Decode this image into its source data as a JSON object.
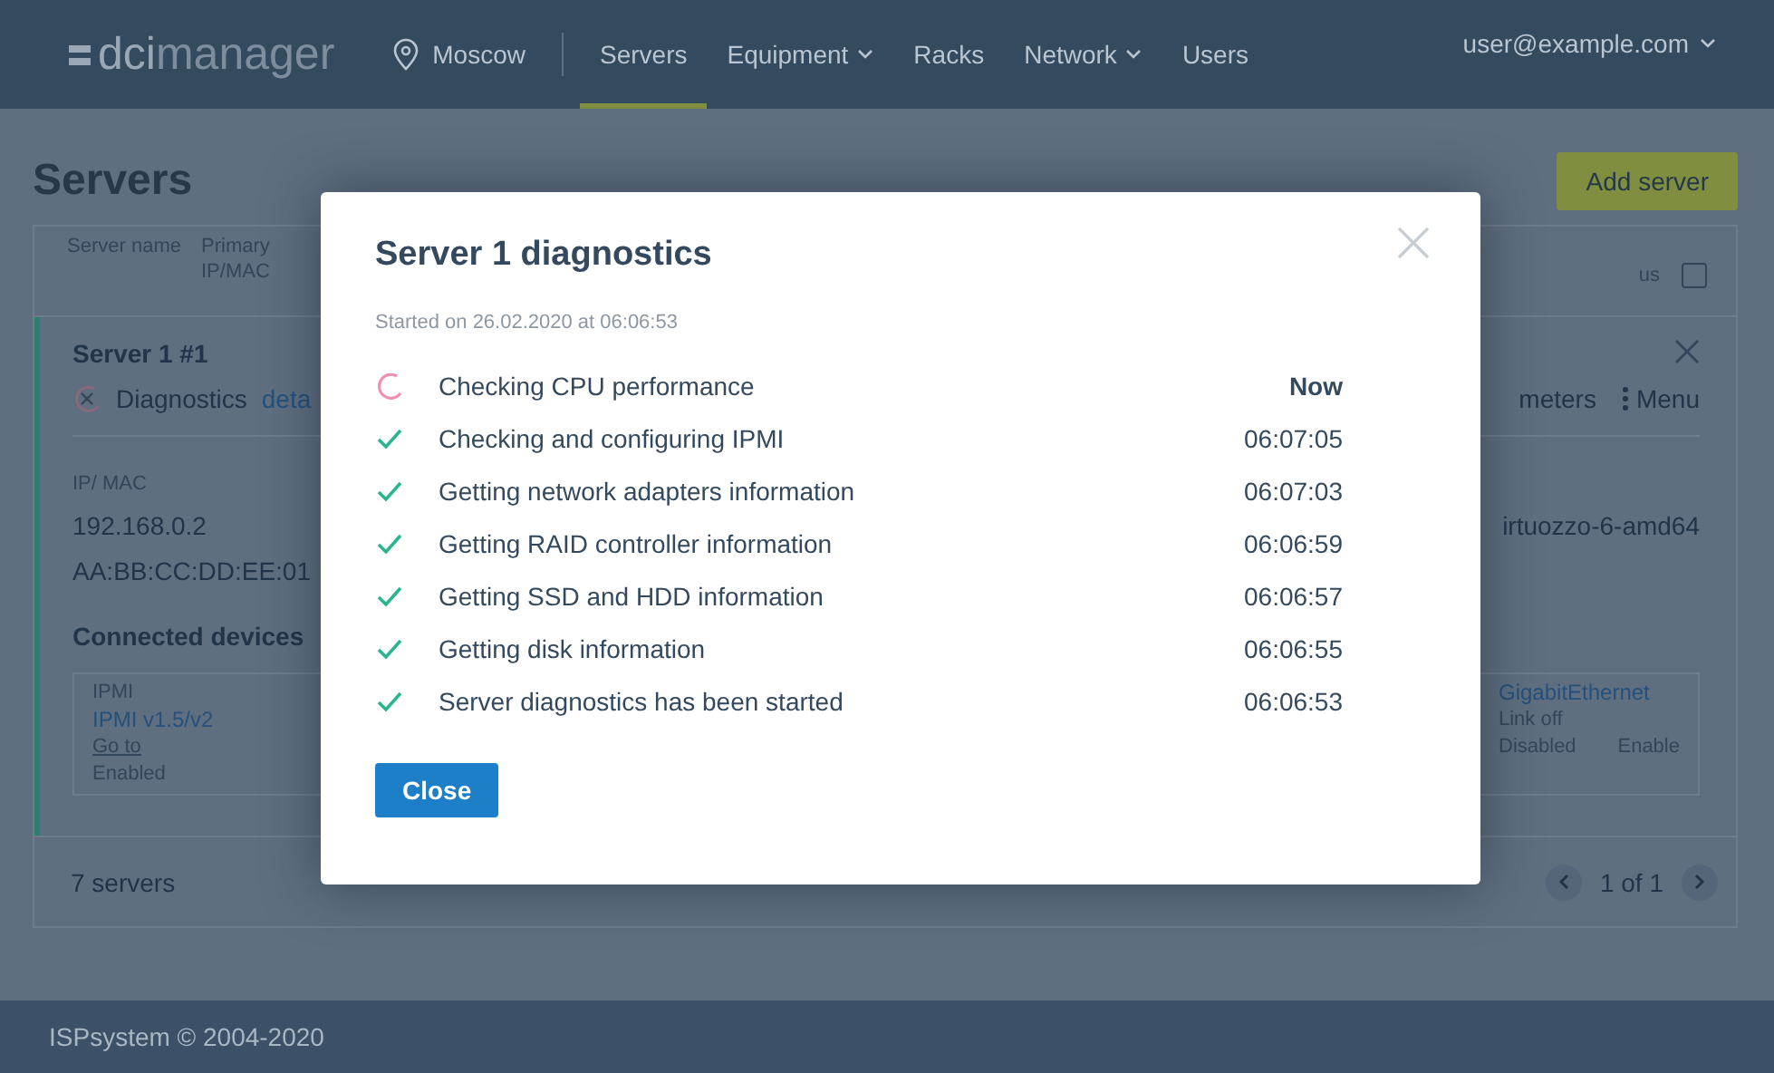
{
  "header": {
    "logo": {
      "bold": "dci",
      "light": "manager"
    },
    "location": "Moscow",
    "nav": [
      {
        "label": "Servers",
        "selected": true,
        "dropdown": false
      },
      {
        "label": "Equipment",
        "selected": false,
        "dropdown": true
      },
      {
        "label": "Racks",
        "selected": false,
        "dropdown": false
      },
      {
        "label": "Network",
        "selected": false,
        "dropdown": true
      },
      {
        "label": "Users",
        "selected": false,
        "dropdown": false
      }
    ],
    "user": "user@example.com"
  },
  "page": {
    "title": "Servers",
    "add_button": "Add server",
    "table": {
      "columns": [
        {
          "label": "Server name"
        },
        {
          "label": "Primary IP/MAC"
        },
        {
          "label": "us"
        }
      ],
      "select_all": {
        "checked": false
      },
      "card": {
        "name": "Server 1 #1",
        "status": "Diagnostics",
        "details_link": "deta",
        "params_action": "meters",
        "menu_action": "Menu",
        "ip_label": "IP/ MAC",
        "ip": "192.168.0.2",
        "mac": "AA:BB:CC:DD:EE:01",
        "os": "irtuozzo-6-amd64",
        "devices_title": "Connected devices",
        "ipmi": {
          "legend": "IPMI",
          "name": "IPMI v1.5/v2",
          "link": "Go to",
          "state": "Enabled"
        },
        "switch": {
          "name": "GigabitEthernet",
          "link": "Link off",
          "state": "Disabled",
          "action": "Enable"
        }
      },
      "footer": {
        "count": "7 servers",
        "pages": "1 of 1"
      }
    }
  },
  "modal": {
    "title": "Server 1 diagnostics",
    "started": "Started on 26.02.2020 at 06:06:53",
    "steps": [
      {
        "label": "Checking CPU performance",
        "time": "Now",
        "kind": "running"
      },
      {
        "label": "Checking and configuring IPMI",
        "time": "06:07:05",
        "kind": "done"
      },
      {
        "label": "Getting network adapters information",
        "time": "06:07:03",
        "kind": "done"
      },
      {
        "label": "Getting RAID controller information",
        "time": "06:06:59",
        "kind": "done"
      },
      {
        "label": "Getting SSD and HDD information",
        "time": "06:06:57",
        "kind": "done"
      },
      {
        "label": "Getting disk information",
        "time": "06:06:55",
        "kind": "done"
      },
      {
        "label": "Server diagnostics has been started",
        "time": "06:06:53",
        "kind": "done"
      }
    ],
    "close_button": "Close"
  },
  "footer": {
    "copyright": "ISPsystem © 2004-2020"
  }
}
